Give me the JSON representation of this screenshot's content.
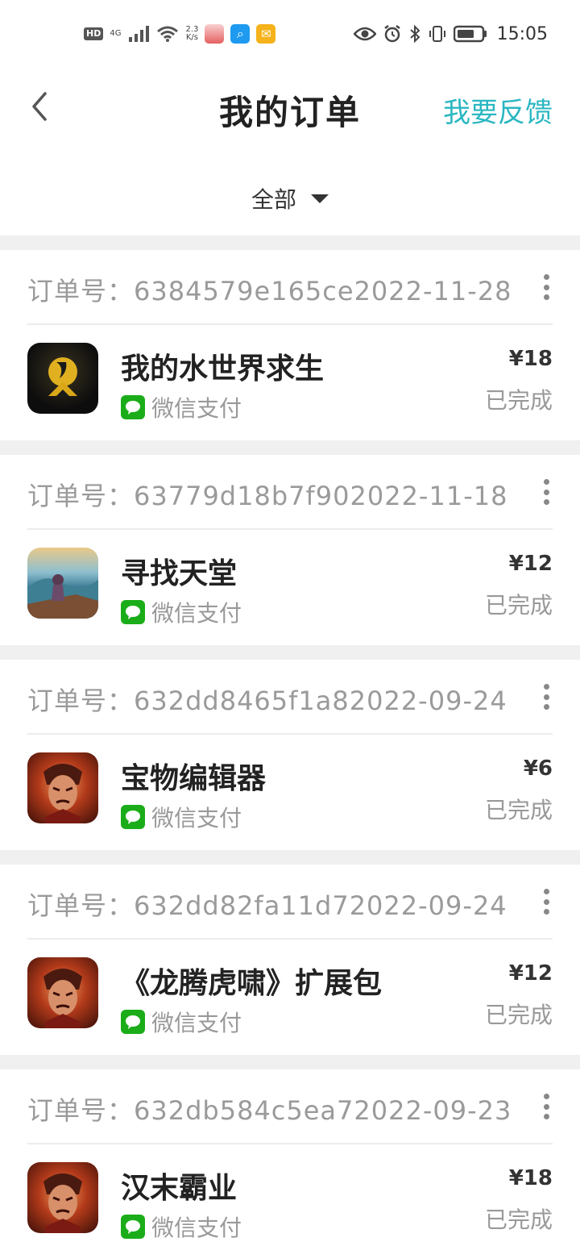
{
  "status_bar": {
    "badge_hd": "HD",
    "net_type": "4G",
    "net_speed_value": "2.3",
    "net_speed_unit": "K/s",
    "time": "15:05"
  },
  "header": {
    "title": "我的订单",
    "feedback_label": "我要反馈"
  },
  "filter": {
    "selected": "全部"
  },
  "orders": [
    {
      "order_id": "订单号：6384579e165ce2022-11-28",
      "name": "我的水世界求生",
      "payment": "微信支付",
      "price": "¥18",
      "status": "已完成",
      "icon": "water-world-icon"
    },
    {
      "order_id": "订单号：63779d18b7f902022-11-18",
      "name": "寻找天堂",
      "payment": "微信支付",
      "price": "¥12",
      "status": "已完成",
      "icon": "paradise-icon"
    },
    {
      "order_id": "订单号：632dd8465f1a82022-09-24",
      "name": "宝物编辑器",
      "payment": "微信支付",
      "price": "¥6",
      "status": "已完成",
      "icon": "warrior-icon"
    },
    {
      "order_id": "订单号：632dd82fa11d72022-09-24",
      "name": "《龙腾虎啸》扩展包",
      "payment": "微信支付",
      "price": "¥12",
      "status": "已完成",
      "icon": "warrior-icon"
    },
    {
      "order_id": "订单号：632db584c5ea72022-09-23",
      "name": "汉末霸业",
      "payment": "微信支付",
      "price": "¥18",
      "status": "已完成",
      "icon": "warrior-icon"
    }
  ],
  "colors": {
    "accent": "#2ab7c2",
    "wechat_green": "#1aad19",
    "divider": "#f0f0f0"
  }
}
